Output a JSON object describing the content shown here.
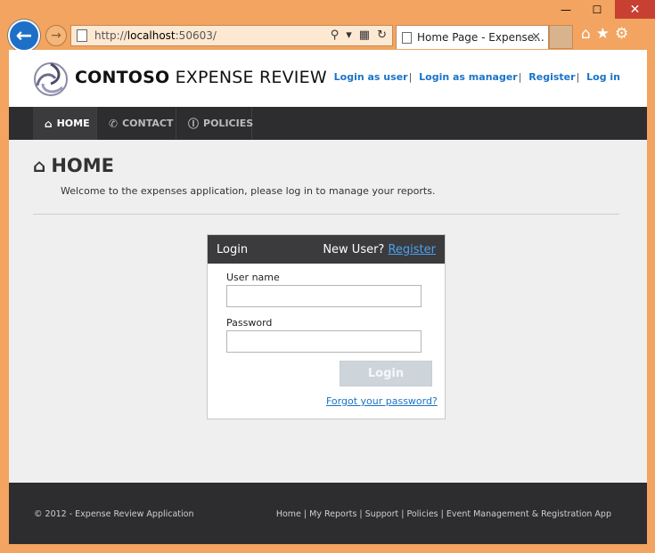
{
  "browser": {
    "url_prefix": "http://",
    "url_host": "localhost",
    "url_rest": ":50603/",
    "tab_title": "Home Page - Expense...",
    "tab_close": "×",
    "win_min": "—",
    "win_max": "☐",
    "win_close": "✕"
  },
  "header": {
    "brand_bold": "CONTOSO",
    "brand_rest": " EXPENSE REVIEW",
    "links": [
      {
        "label": "Login as user"
      },
      {
        "label": "Login as manager"
      },
      {
        "label": "Register"
      },
      {
        "label": "Log in"
      }
    ],
    "separator": "|"
  },
  "nav": {
    "items": [
      {
        "label": "HOME"
      },
      {
        "label": "CONTACT"
      },
      {
        "label": "POLICIES"
      }
    ]
  },
  "main": {
    "title": "HOME",
    "welcome": "Welcome to the expenses application, please log in to manage your reports."
  },
  "login": {
    "heading": "Login",
    "new_user_text": "New User? ",
    "register_link": "Register",
    "username_label": "User name",
    "username_value": "",
    "password_label": "Password",
    "password_value": "",
    "submit": "Login",
    "forgot": "Forgot your password?"
  },
  "footer": {
    "copyright": "© 2012 - Expense Review Application",
    "links": [
      "Home",
      "My Reports",
      "Support",
      "Policies",
      "Event Management & Registration App"
    ],
    "separator": " | "
  },
  "colors": {
    "frame": "#f2a460",
    "accent_link": "#1a73c8",
    "nav_bg": "#2d2d30",
    "page_bg": "#efefef"
  }
}
